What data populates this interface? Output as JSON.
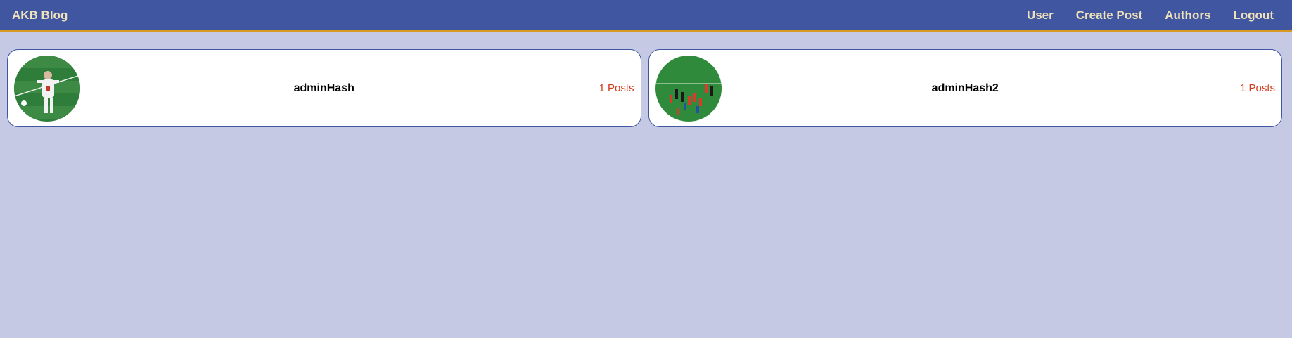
{
  "navbar": {
    "brand": "AKB Blog",
    "links": [
      "User",
      "Create Post",
      "Authors",
      "Logout"
    ]
  },
  "authors": [
    {
      "name": "adminHash",
      "posts": "1 Posts"
    },
    {
      "name": "adminHash2",
      "posts": "1 Posts"
    }
  ],
  "colors": {
    "navbar_bg": "#4056a1",
    "navbar_accent": "#d79922",
    "nav_text": "#efe2ba",
    "page_bg": "#c5c9e4",
    "post_count": "#d23a19"
  }
}
